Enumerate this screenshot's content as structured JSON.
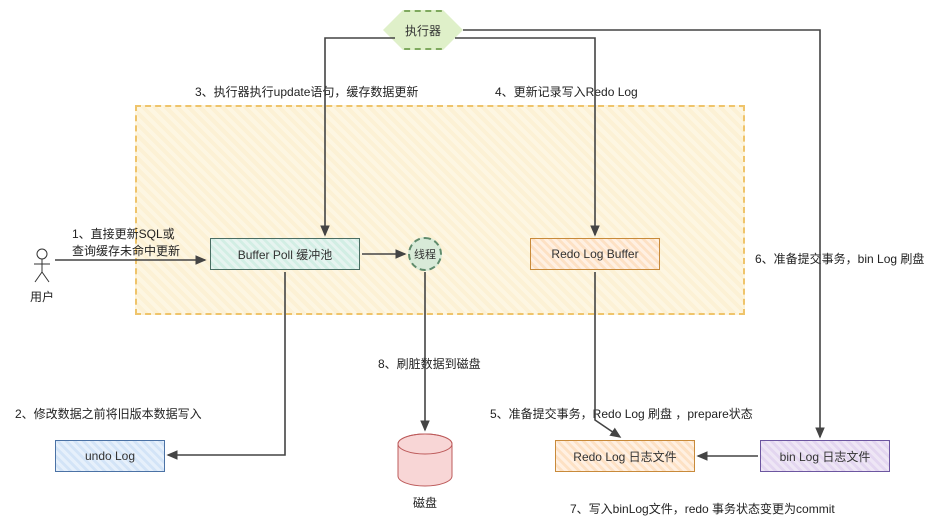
{
  "nodes": {
    "executor": "执行器",
    "user": "用户",
    "buffer_pool": "Buffer Poll 缓冲池",
    "thread": "线程",
    "redo_buffer": "Redo Log Buffer",
    "undo_log": "undo Log",
    "disk": "磁盘",
    "redo_file": "Redo Log 日志文件",
    "bin_file": "bin Log 日志文件"
  },
  "labels": {
    "l1": "1、直接更新SQL或\n查询缓存未命中更新",
    "l2": "2、修改数据之前将旧版本数据写入",
    "l3": "3、执行器执行update语句，缓存数据更新",
    "l4": "4、更新记录写入Redo Log",
    "l5": "5、准备提交事务，Redo Log 刷盘 ，prepare状态",
    "l6": "6、准备提交事务，bin Log 刷盘",
    "l7": "7、写入binLog文件，redo 事务状态变更为commit",
    "l8": "8、刷脏数据到磁盘"
  }
}
